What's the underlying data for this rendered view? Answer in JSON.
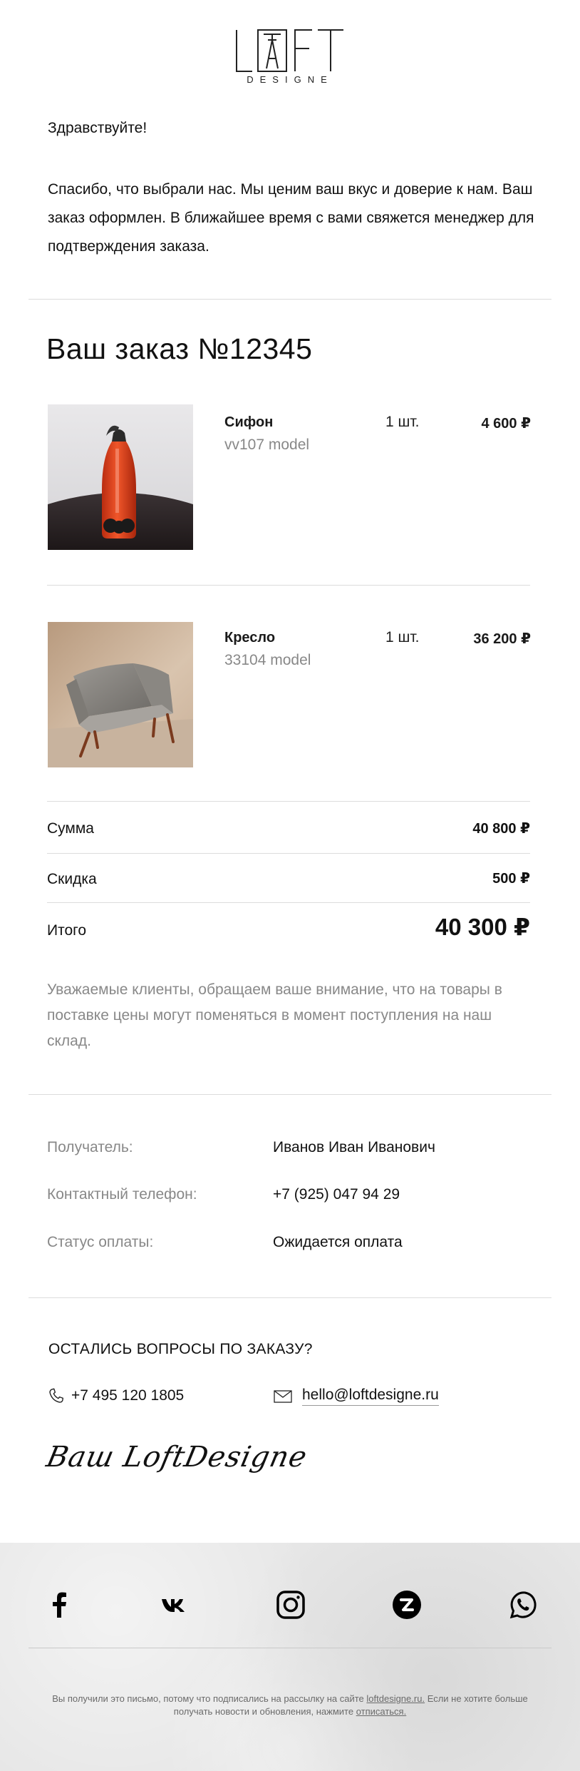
{
  "brand": {
    "logo_text": "LOFT",
    "logo_sub": "DESIGNE"
  },
  "greeting": "Здравствуйте!",
  "intro": "Спасибо, что выбрали нас. Мы ценим ваш вкус и доверие к нам. Ваш заказ оформлен. В ближайшее время с вами свяжется менеджер для подтверждения заказа.",
  "order": {
    "title": "Ваш заказ №12345",
    "items": [
      {
        "name": "Сифон",
        "model": "vv107 model",
        "qty": "1 шт.",
        "price": "4 600 ₽",
        "image": "siphon-photo"
      },
      {
        "name": "Кресло",
        "model": "33104 model",
        "qty": "1 шт.",
        "price": "36 200 ₽",
        "image": "armchair-photo"
      }
    ],
    "totals": {
      "sum_label": "Сумма",
      "sum_value": "40 800 ₽",
      "discount_label": "Скидка",
      "discount_value": "500 ₽",
      "total_label": "Итого",
      "total_value": "40 300 ₽"
    },
    "notice": "Уважаемые клиенты, обращаем ваше внимание, что на товары в поставке цены могут поменяться в момент поступления на наш склад."
  },
  "recipient": {
    "name_label": "Получатель:",
    "name_value": "Иванов Иван Иванович",
    "phone_label": "Контактный телефон:",
    "phone_value": "+7 (925) 047 94 29",
    "status_label": "Статус оплаты:",
    "status_value": "Ожидается оплата"
  },
  "questions": {
    "title": "ОСТАЛИСЬ ВОПРОСЫ ПО ЗАКАЗУ?",
    "phone": "+7 495 120 1805",
    "email": "hello@loftdesigne.ru",
    "phone_icon": "phone-icon",
    "email_icon": "envelope-icon"
  },
  "signature": "Ваш LoftDesigne",
  "footer": {
    "social": [
      "facebook-icon",
      "vk-icon",
      "instagram-icon",
      "zen-icon",
      "whatsapp-icon"
    ],
    "text_1": "Вы получили это письмо, потому что подписались на рассылку на сайте",
    "site_link": "loftdesigne.ru.",
    "text_2": "Если не хотите больше получать новости и обновления, нажмите",
    "unsubscribe": "отписаться."
  },
  "colors": {
    "background": "#ffffff",
    "footer_bg": "#e7e7e7",
    "text": "#111111",
    "muted": "#888888",
    "divider": "#dcdcdc",
    "siphon_red": "#e5401a"
  }
}
